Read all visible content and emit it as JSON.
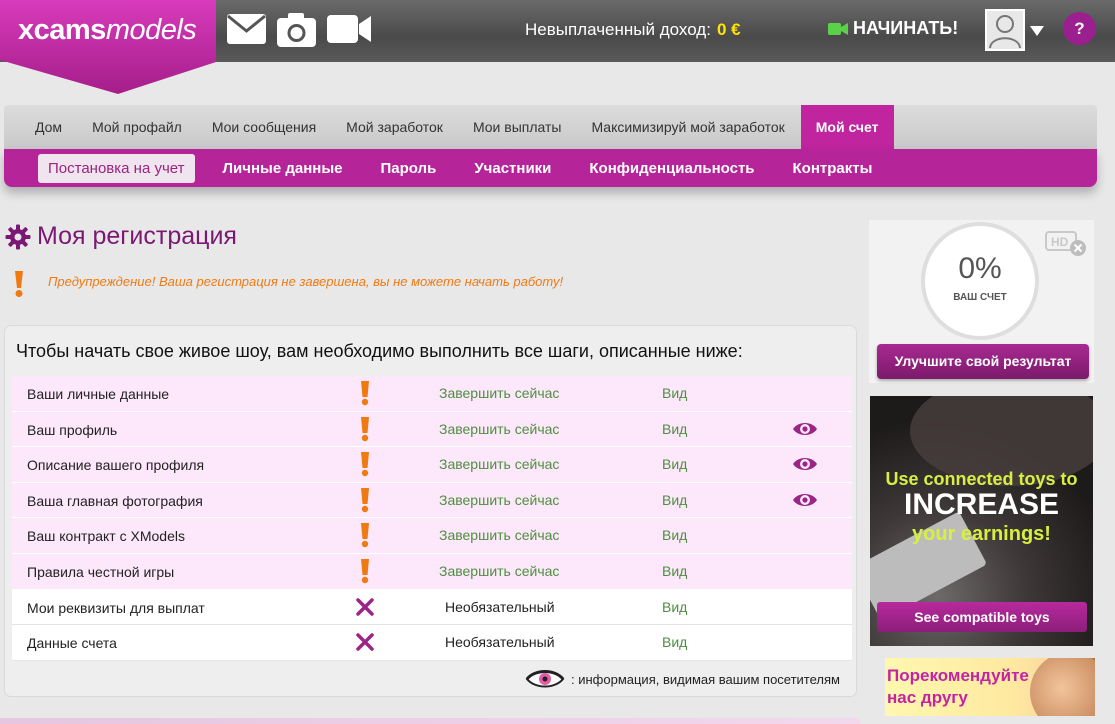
{
  "header": {
    "logo_bold": "xcams",
    "logo_italic": "models",
    "earnings_label": "Невыплаченный доход:",
    "earnings_value": "0 €",
    "start_label": "НАЧИНАТЬ!",
    "help_label": "?",
    "icons": [
      "mail-icon",
      "camera-icon",
      "video-camera-icon",
      "user-avatar-icon",
      "help-icon"
    ]
  },
  "nav": {
    "tabs": [
      {
        "label": "Дом"
      },
      {
        "label": "Мой профайл"
      },
      {
        "label": "Мои сообщения"
      },
      {
        "label": "Мой заработок"
      },
      {
        "label": "Мои выплаты"
      },
      {
        "label": "Максимизируй мой заработок"
      },
      {
        "label": "Мой счет"
      }
    ],
    "active_tab": "Мой счет",
    "subtabs": [
      {
        "label": "Постановка на учет"
      },
      {
        "label": "Личные данные"
      },
      {
        "label": "Пароль"
      },
      {
        "label": "Участники"
      },
      {
        "label": "Конфиденциальность"
      },
      {
        "label": "Контракты"
      }
    ],
    "active_subtab": "Постановка на учет"
  },
  "page": {
    "title": "Моя регистрация",
    "warning": "Предупреждение! Ваша регистрация не завершена, вы не можете начать работу!"
  },
  "steps": {
    "intro": "Чтобы начать свое живое шоу, вам необходимо выполнить все шаги, описанные ниже:",
    "rows": [
      {
        "name": "Ваши личные данные",
        "status": "required",
        "action": "Завершить сейчас",
        "view": "Вид",
        "visible": false
      },
      {
        "name": "Ваш профиль",
        "status": "required",
        "action": "Завершить сейчас",
        "view": "Вид",
        "visible": true
      },
      {
        "name": "Описание вашего профиля",
        "status": "required",
        "action": "Завершить сейчас",
        "view": "Вид",
        "visible": true
      },
      {
        "name": "Ваша главная фотография",
        "status": "required",
        "action": "Завершить сейчас",
        "view": "Вид",
        "visible": true
      },
      {
        "name": "Ваш контракт с XModels",
        "status": "required",
        "action": "Завершить сейчас",
        "view": "Вид",
        "visible": false
      },
      {
        "name": "Правила честной игры",
        "status": "required",
        "action": "Завершить сейчас",
        "view": "Вид",
        "visible": false
      },
      {
        "name": "Мои реквизиты для выплат",
        "status": "optional",
        "action": "Необязательный",
        "view": "Вид",
        "visible": false
      },
      {
        "name": "Данные счета",
        "status": "optional",
        "action": "Необязательный",
        "view": "Вид",
        "visible": false
      }
    ],
    "legend": ": информация, видимая вашим посетителям"
  },
  "score": {
    "percent": "0%",
    "label": "ВАШ СЧЕТ",
    "button": "Улучшите свой результат"
  },
  "ad": {
    "line1": "Use connected toys to",
    "line2": "INCREASE",
    "line3": "your earnings!",
    "button": "See compatible toys"
  },
  "refer": {
    "line1": "Порекомендуйте",
    "line2": "нас другу"
  },
  "colors": {
    "brand": "#b6249a",
    "warning": "#f07a12",
    "action_green": "#4d8f3f",
    "earnings_yellow": "#ffe400"
  }
}
